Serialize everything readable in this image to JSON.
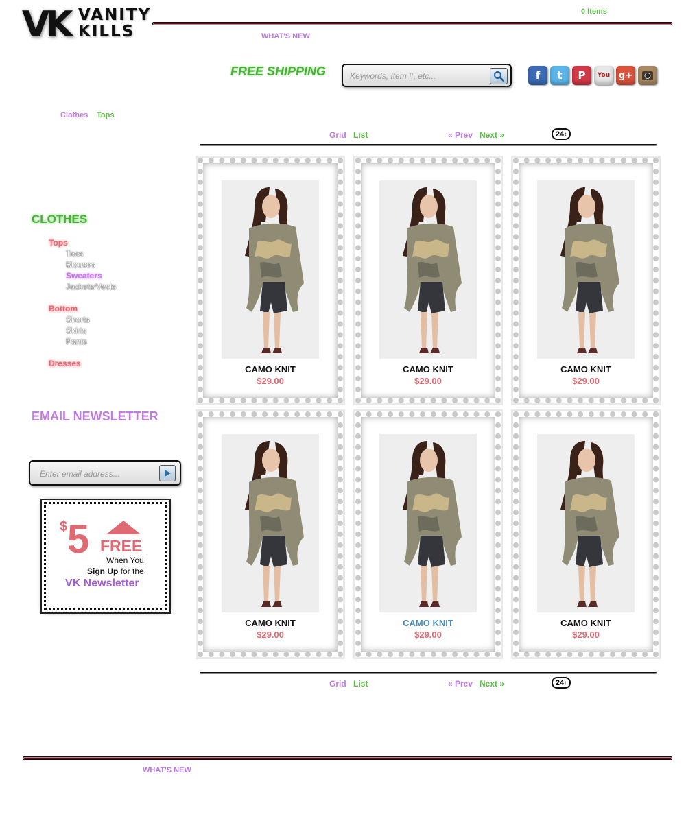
{
  "brand": {
    "logo_initials": "VK",
    "logo_line1": "VANITY",
    "logo_line2": "KILLS"
  },
  "cart": {
    "label": "0 Items"
  },
  "nav": {
    "top_link": "WHAT'S NEW",
    "bottom_link": "WHAT'S NEW"
  },
  "promo_header": {
    "free_shipping": "FREE SHIPPING"
  },
  "search": {
    "placeholder": "Keywords, Item #, etc..."
  },
  "social": [
    "facebook-icon",
    "twitter-icon",
    "pinterest-icon",
    "youtube-icon",
    "google-plus-icon",
    "instagram-icon"
  ],
  "breadcrumb": {
    "items": [
      "Clothes",
      "Tops"
    ]
  },
  "toolbar": {
    "grid": "Grid",
    "list": "List",
    "prev": "« Prev",
    "next": "Next »",
    "per_page": "24"
  },
  "sidebar": {
    "title": "CLOTHES",
    "categories": [
      {
        "label": "Tops",
        "subs": [
          "Tees",
          "Blouses",
          "Sweaters",
          "Jackets/Vests"
        ]
      },
      {
        "label": "Bottom",
        "subs": [
          "Shorts",
          "Skirts",
          "Pants"
        ]
      },
      {
        "label": "Dresses",
        "subs": []
      }
    ],
    "active_sub": "Sweaters"
  },
  "newsletter": {
    "title": "EMAIL NEWSLETTER",
    "placeholder": "Enter email address...",
    "promo_dollar": "$",
    "promo_amount": "5",
    "promo_free": "FREE",
    "promo_line1": "When You",
    "promo_signup": "Sign Up",
    "promo_for": "for the",
    "promo_line3": "VK Newsletter"
  },
  "products": [
    {
      "name": "CAMO KNIT",
      "price": "$29.00"
    },
    {
      "name": "CAMO KNIT",
      "price": "$29.00"
    },
    {
      "name": "CAMO KNIT",
      "price": "$29.00"
    },
    {
      "name": "CAMO KNIT",
      "price": "$29.00"
    },
    {
      "name": "CAMO KNIT",
      "price": "$29.00"
    },
    {
      "name": "CAMO KNIT",
      "price": "$29.00"
    }
  ],
  "colors": {
    "green": "#5dbb48",
    "purple": "#c27be3",
    "pink": "#e06a74",
    "hover_blue": "#4a8fb8"
  }
}
